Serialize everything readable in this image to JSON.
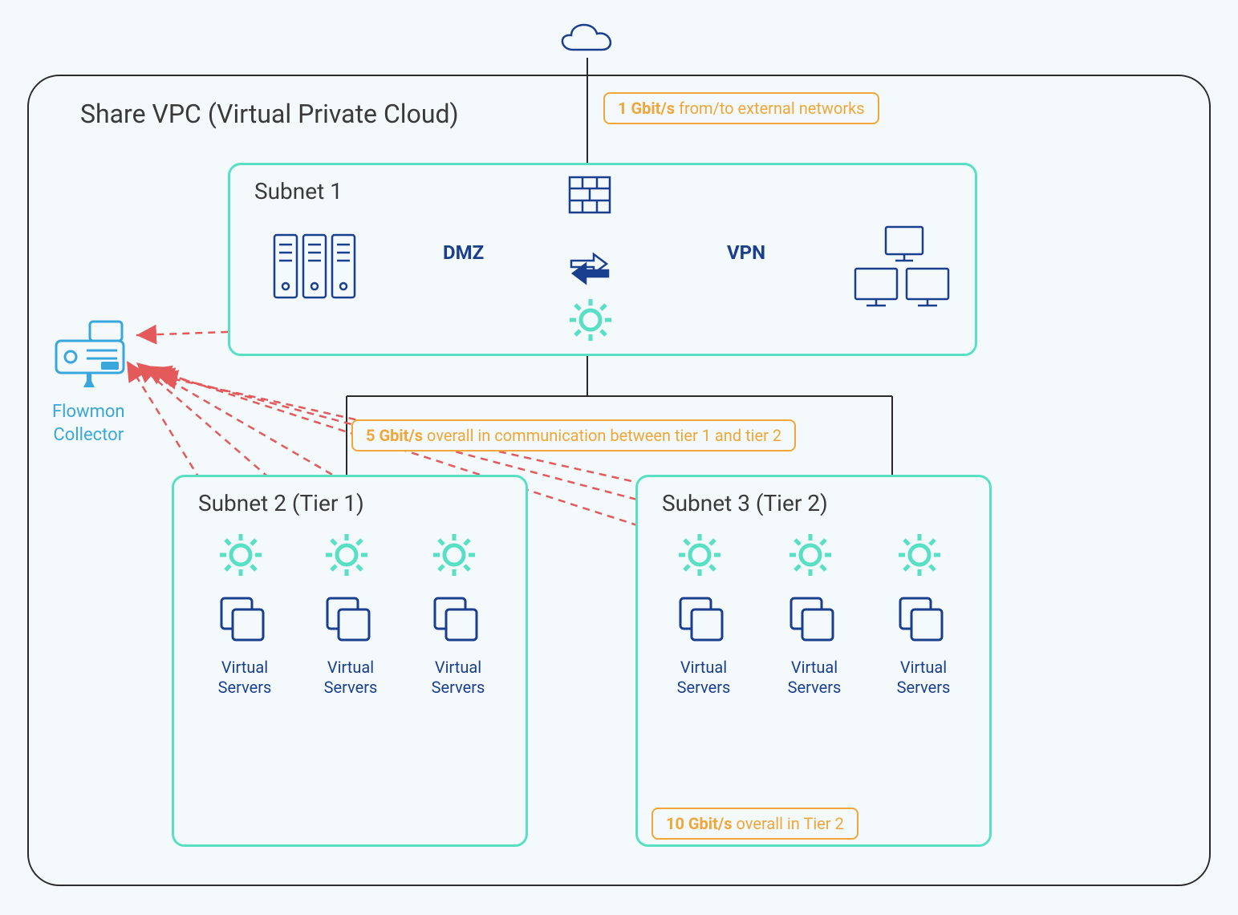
{
  "diagram": {
    "vpc_title": "Share VPC (Virtual Private Cloud)",
    "subnet1_title": "Subnet 1",
    "subnet2_title": "Subnet 2 (Tier 1)",
    "subnet3_title": "Subnet 3 (Tier 2)",
    "dmz_label": "DMZ",
    "vpn_label": "VPN",
    "collector_label_1": "Flowmon",
    "collector_label_2": "Collector",
    "vs_label_1": "Virtual",
    "vs_label_2": "Servers",
    "callout_ext_strong": "1 Gbit/s",
    "callout_ext_rest": " from/to external networks",
    "callout_mid_strong": "5 Gbit/s",
    "callout_mid_rest": " overall in communication between tier 1 and tier 2",
    "callout_t2_strong": "10 Gbit/s",
    "callout_t2_rest": " overall in Tier 2"
  },
  "colors": {
    "navy": "#1b3f8f",
    "teal": "#59e0c4",
    "orange": "#f0a638",
    "black": "#2b2b2b",
    "red": "#e45a5a",
    "light_blue": "#39a6dd"
  }
}
